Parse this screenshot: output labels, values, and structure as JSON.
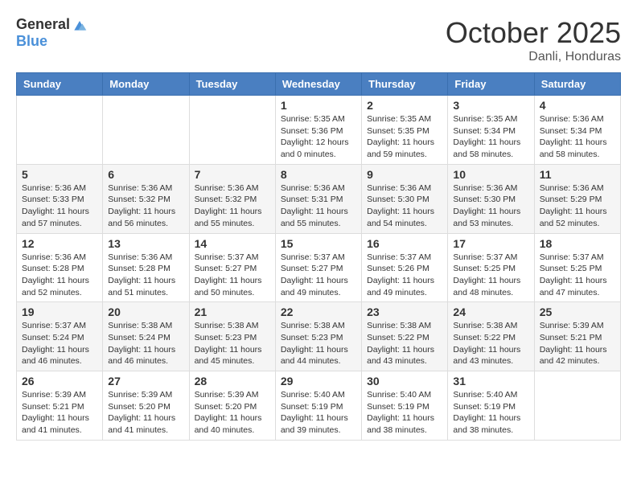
{
  "logo": {
    "general": "General",
    "blue": "Blue"
  },
  "title": "October 2025",
  "subtitle": "Danli, Honduras",
  "days_of_week": [
    "Sunday",
    "Monday",
    "Tuesday",
    "Wednesday",
    "Thursday",
    "Friday",
    "Saturday"
  ],
  "weeks": [
    [
      {
        "day": "",
        "info": ""
      },
      {
        "day": "",
        "info": ""
      },
      {
        "day": "",
        "info": ""
      },
      {
        "day": "1",
        "info": "Sunrise: 5:35 AM\nSunset: 5:36 PM\nDaylight: 12 hours\nand 0 minutes."
      },
      {
        "day": "2",
        "info": "Sunrise: 5:35 AM\nSunset: 5:35 PM\nDaylight: 11 hours\nand 59 minutes."
      },
      {
        "day": "3",
        "info": "Sunrise: 5:35 AM\nSunset: 5:34 PM\nDaylight: 11 hours\nand 58 minutes."
      },
      {
        "day": "4",
        "info": "Sunrise: 5:36 AM\nSunset: 5:34 PM\nDaylight: 11 hours\nand 58 minutes."
      }
    ],
    [
      {
        "day": "5",
        "info": "Sunrise: 5:36 AM\nSunset: 5:33 PM\nDaylight: 11 hours\nand 57 minutes."
      },
      {
        "day": "6",
        "info": "Sunrise: 5:36 AM\nSunset: 5:32 PM\nDaylight: 11 hours\nand 56 minutes."
      },
      {
        "day": "7",
        "info": "Sunrise: 5:36 AM\nSunset: 5:32 PM\nDaylight: 11 hours\nand 55 minutes."
      },
      {
        "day": "8",
        "info": "Sunrise: 5:36 AM\nSunset: 5:31 PM\nDaylight: 11 hours\nand 55 minutes."
      },
      {
        "day": "9",
        "info": "Sunrise: 5:36 AM\nSunset: 5:30 PM\nDaylight: 11 hours\nand 54 minutes."
      },
      {
        "day": "10",
        "info": "Sunrise: 5:36 AM\nSunset: 5:30 PM\nDaylight: 11 hours\nand 53 minutes."
      },
      {
        "day": "11",
        "info": "Sunrise: 5:36 AM\nSunset: 5:29 PM\nDaylight: 11 hours\nand 52 minutes."
      }
    ],
    [
      {
        "day": "12",
        "info": "Sunrise: 5:36 AM\nSunset: 5:28 PM\nDaylight: 11 hours\nand 52 minutes."
      },
      {
        "day": "13",
        "info": "Sunrise: 5:36 AM\nSunset: 5:28 PM\nDaylight: 11 hours\nand 51 minutes."
      },
      {
        "day": "14",
        "info": "Sunrise: 5:37 AM\nSunset: 5:27 PM\nDaylight: 11 hours\nand 50 minutes."
      },
      {
        "day": "15",
        "info": "Sunrise: 5:37 AM\nSunset: 5:27 PM\nDaylight: 11 hours\nand 49 minutes."
      },
      {
        "day": "16",
        "info": "Sunrise: 5:37 AM\nSunset: 5:26 PM\nDaylight: 11 hours\nand 49 minutes."
      },
      {
        "day": "17",
        "info": "Sunrise: 5:37 AM\nSunset: 5:25 PM\nDaylight: 11 hours\nand 48 minutes."
      },
      {
        "day": "18",
        "info": "Sunrise: 5:37 AM\nSunset: 5:25 PM\nDaylight: 11 hours\nand 47 minutes."
      }
    ],
    [
      {
        "day": "19",
        "info": "Sunrise: 5:37 AM\nSunset: 5:24 PM\nDaylight: 11 hours\nand 46 minutes."
      },
      {
        "day": "20",
        "info": "Sunrise: 5:38 AM\nSunset: 5:24 PM\nDaylight: 11 hours\nand 46 minutes."
      },
      {
        "day": "21",
        "info": "Sunrise: 5:38 AM\nSunset: 5:23 PM\nDaylight: 11 hours\nand 45 minutes."
      },
      {
        "day": "22",
        "info": "Sunrise: 5:38 AM\nSunset: 5:23 PM\nDaylight: 11 hours\nand 44 minutes."
      },
      {
        "day": "23",
        "info": "Sunrise: 5:38 AM\nSunset: 5:22 PM\nDaylight: 11 hours\nand 43 minutes."
      },
      {
        "day": "24",
        "info": "Sunrise: 5:38 AM\nSunset: 5:22 PM\nDaylight: 11 hours\nand 43 minutes."
      },
      {
        "day": "25",
        "info": "Sunrise: 5:39 AM\nSunset: 5:21 PM\nDaylight: 11 hours\nand 42 minutes."
      }
    ],
    [
      {
        "day": "26",
        "info": "Sunrise: 5:39 AM\nSunset: 5:21 PM\nDaylight: 11 hours\nand 41 minutes."
      },
      {
        "day": "27",
        "info": "Sunrise: 5:39 AM\nSunset: 5:20 PM\nDaylight: 11 hours\nand 41 minutes."
      },
      {
        "day": "28",
        "info": "Sunrise: 5:39 AM\nSunset: 5:20 PM\nDaylight: 11 hours\nand 40 minutes."
      },
      {
        "day": "29",
        "info": "Sunrise: 5:40 AM\nSunset: 5:19 PM\nDaylight: 11 hours\nand 39 minutes."
      },
      {
        "day": "30",
        "info": "Sunrise: 5:40 AM\nSunset: 5:19 PM\nDaylight: 11 hours\nand 38 minutes."
      },
      {
        "day": "31",
        "info": "Sunrise: 5:40 AM\nSunset: 5:19 PM\nDaylight: 11 hours\nand 38 minutes."
      },
      {
        "day": "",
        "info": ""
      }
    ]
  ]
}
